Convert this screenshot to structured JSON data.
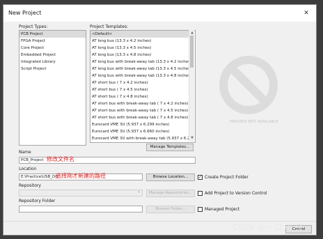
{
  "dialog": {
    "title": "New Project",
    "close_glyph": "✕"
  },
  "project_types": {
    "label": "Project Types:",
    "items": [
      "PCB Project",
      "FPGA Project",
      "Core Project",
      "Embedded Project",
      "Integrated Library",
      "Script Project"
    ],
    "selected_index": 0
  },
  "project_templates": {
    "label": "Project Templates:",
    "items": [
      "<Default>",
      "AT long bus (13.3 x 4.2 inches)",
      "AT long bus (13.3 x 4.5 inches)",
      "AT long bus (13.3 x 4.8 inches)",
      "AT long bus with break-away tab (13.3 x 4.2 inches)",
      "AT long bus with break-away tab (13.3 x 4.5 inches)",
      "AT long bus with break-away tab (13.3 x 4.8 inches)",
      "AT short bus ( 7 x 4.2 inches)",
      "AT short bus ( 7 x 4.5 inches)",
      "AT short bus ( 7 x 4.8 inches)",
      "AT short bus with break-away tab ( 7 x 4.2 inches)",
      "AT short bus with break-away tab ( 7 x 4.5 inches)",
      "AT short bus with break-away tab ( 7 x 4.8 inches)",
      "Eurocard VME 3U (5.937 x 6.299 inches)",
      "Eurocard VME 3U (5.937 x 6.660 inches)",
      "Eurocard VME 3U with break-away tab (5.937 x 6.299 ..."
    ],
    "selected_index": 0,
    "manage_button": "Manage Templates..."
  },
  "preview": {
    "caption": "PREVIEW NOT AVAILABLE",
    "icon": "no-entry-icon"
  },
  "name": {
    "label": "Name",
    "value": "PCB_Project",
    "annotation": "修改文件名"
  },
  "location": {
    "label": "Location",
    "value": "E:\\Practice\\USB_DO",
    "annotation": "选择刚才新建的路径",
    "browse_button": "Browse Location...",
    "create_folder_label": "Create Project Folder",
    "create_folder_checked": true
  },
  "repository": {
    "label": "Repository",
    "value": "",
    "manage_button": "Manage Repositories...",
    "version_control_label": "Add Project to Version Control",
    "version_control_checked": false
  },
  "repository_folder": {
    "label": "Repository Folder",
    "value": "",
    "browse_button": "Browse Folder...",
    "managed_label": "Managed Project",
    "managed_checked": false
  },
  "footer": {
    "cancel_button": "Cancel"
  },
  "watermark": "CSDN @一 口 小 只"
}
